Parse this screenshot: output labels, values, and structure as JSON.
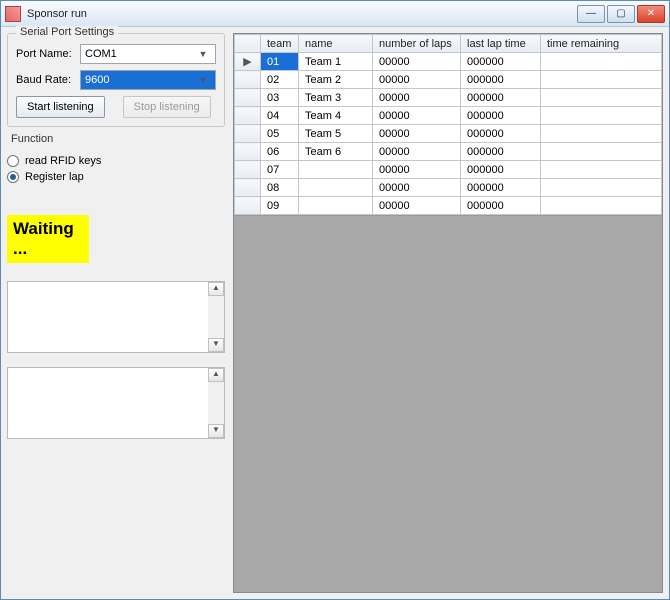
{
  "window": {
    "title": "Sponsor run"
  },
  "serial": {
    "legend": "Serial Port Settings",
    "port_label": "Port Name:",
    "port_value": "COM1",
    "baud_label": "Baud Rate:",
    "baud_value": "9600",
    "start_label": "Start listening",
    "stop_label": "Stop listening"
  },
  "function": {
    "legend": "Function",
    "read_label": "read RFID keys",
    "register_label": "Register lap",
    "selected": "register"
  },
  "status": {
    "text": "Waiting ..."
  },
  "grid": {
    "headers": {
      "team": "team",
      "name": "name",
      "laps": "number of laps",
      "last": "last lap time",
      "remaining": "time remaining"
    },
    "rows": [
      {
        "team": "01",
        "name": "Team 1",
        "laps": "00000",
        "last": "000000",
        "remaining": ""
      },
      {
        "team": "02",
        "name": "Team 2",
        "laps": "00000",
        "last": "000000",
        "remaining": ""
      },
      {
        "team": "03",
        "name": "Team 3",
        "laps": "00000",
        "last": "000000",
        "remaining": ""
      },
      {
        "team": "04",
        "name": "Team 4",
        "laps": "00000",
        "last": "000000",
        "remaining": ""
      },
      {
        "team": "05",
        "name": "Team 5",
        "laps": "00000",
        "last": "000000",
        "remaining": ""
      },
      {
        "team": "06",
        "name": "Team 6",
        "laps": "00000",
        "last": "000000",
        "remaining": ""
      },
      {
        "team": "07",
        "name": "",
        "laps": "00000",
        "last": "000000",
        "remaining": ""
      },
      {
        "team": "08",
        "name": "",
        "laps": "00000",
        "last": "000000",
        "remaining": ""
      },
      {
        "team": "09",
        "name": "",
        "laps": "00000",
        "last": "000000",
        "remaining": ""
      }
    ],
    "selected_row": 0,
    "current_indicator": "▶"
  }
}
